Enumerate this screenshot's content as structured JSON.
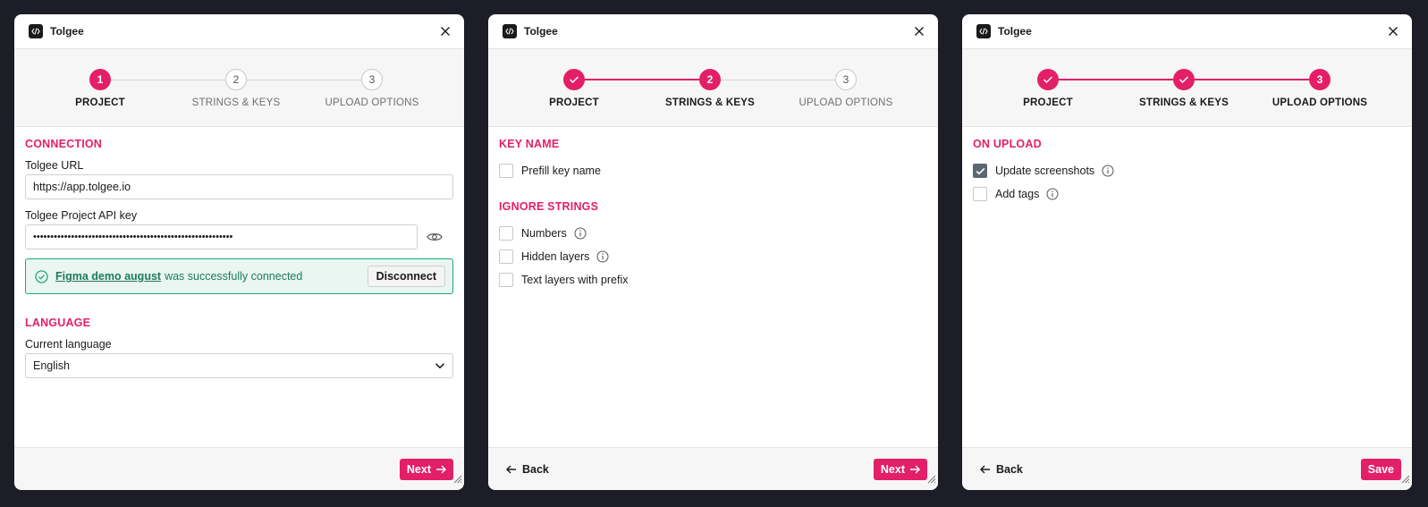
{
  "app": {
    "title": "Tolgee"
  },
  "steps": [
    {
      "num": "1",
      "label": "PROJECT"
    },
    {
      "num": "2",
      "label": "STRINGS & KEYS"
    },
    {
      "num": "3",
      "label": "UPLOAD OPTIONS"
    }
  ],
  "colors": {
    "accent": "#e31f68",
    "success": "#25a57a",
    "background": "#1c1d26"
  },
  "panel1": {
    "connection_heading": "CONNECTION",
    "url_label": "Tolgee URL",
    "url_value": "https://app.tolgee.io",
    "api_label": "Tolgee Project API key",
    "api_value": "••••••••••••••••••••••••••••••••••••••••••••••••••••••••••",
    "success_link": "Figma demo august",
    "success_text": "was successfully connected",
    "disconnect_label": "Disconnect",
    "language_heading": "LANGUAGE",
    "language_label": "Current language",
    "language_value": "English",
    "next_label": "Next"
  },
  "panel2": {
    "key_heading": "KEY NAME",
    "prefill_label": "Prefill key name",
    "ignore_heading": "IGNORE STRINGS",
    "numbers_label": "Numbers",
    "hidden_label": "Hidden layers",
    "prefix_label": "Text layers with prefix",
    "back_label": "Back",
    "next_label": "Next"
  },
  "panel3": {
    "upload_heading": "ON UPLOAD",
    "screenshots_label": "Update screenshots",
    "screenshots_checked": true,
    "tags_label": "Add tags",
    "tags_checked": false,
    "back_label": "Back",
    "save_label": "Save"
  }
}
